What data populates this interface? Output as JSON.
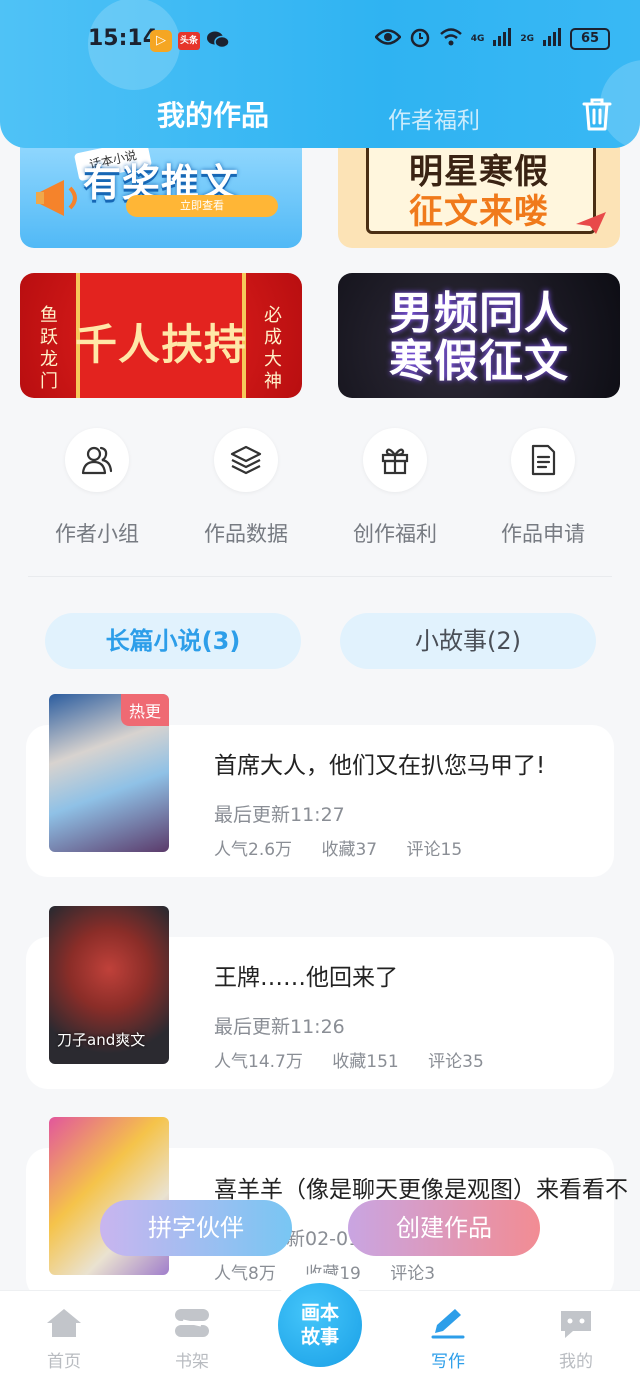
{
  "status_bar": {
    "time": "15:14",
    "app_badge_1": "▷",
    "app_badge_2": "头条",
    "network_1": "4G",
    "network_2": "2G",
    "battery": "65"
  },
  "header": {
    "tab_works": "我的作品",
    "tab_welfare": "作者福利"
  },
  "banners": {
    "b1_title": "有奖推文",
    "b1_tag": "话本小说",
    "b1_button": "立即查看",
    "b2_line1": "明星寒假",
    "b2_line2": "征文来喽",
    "b3_title": "千人扶持",
    "b3_left": "鱼跃龙门",
    "b3_right": "必成大神",
    "b4_line1": "男频同人",
    "b4_line2": "寒假征文"
  },
  "quick_actions": [
    {
      "label": "作者小组",
      "icon": "group-icon"
    },
    {
      "label": "作品数据",
      "icon": "layers-icon"
    },
    {
      "label": "创作福利",
      "icon": "gift-icon"
    },
    {
      "label": "作品申请",
      "icon": "document-icon"
    }
  ],
  "categories": {
    "novel": "长篇小说(3)",
    "story": "小故事(2)"
  },
  "works": [
    {
      "title": "首席大人，他们又在扒您马甲了!",
      "updated": "最后更新11:27",
      "popularity": "人气2.6万",
      "favorites": "收藏37",
      "comments": "评论15",
      "badge": "热更"
    },
    {
      "title": "王牌……他回来了",
      "updated": "最后更新11:26",
      "popularity": "人气14.7万",
      "favorites": "收藏151",
      "comments": "评论35",
      "cover_caption": "刀子and爽文"
    },
    {
      "title": "喜羊羊（像是聊天更像是观图）来看看不",
      "updated": "新02-01",
      "popularity": "人气8万",
      "favorites": "收藏19",
      "comments": "评论3"
    }
  ],
  "floating": {
    "pinzi": "拼字伙伴",
    "create": "创建作品"
  },
  "bottom_nav": {
    "home": "首页",
    "shelf": "书架",
    "center": "画本故事",
    "write": "写作",
    "mine": "我的"
  },
  "colors": {
    "header_blue": "#2fb3f2",
    "accent_blue": "#2d9ee9",
    "pill_bg": "#e1f2fd"
  }
}
